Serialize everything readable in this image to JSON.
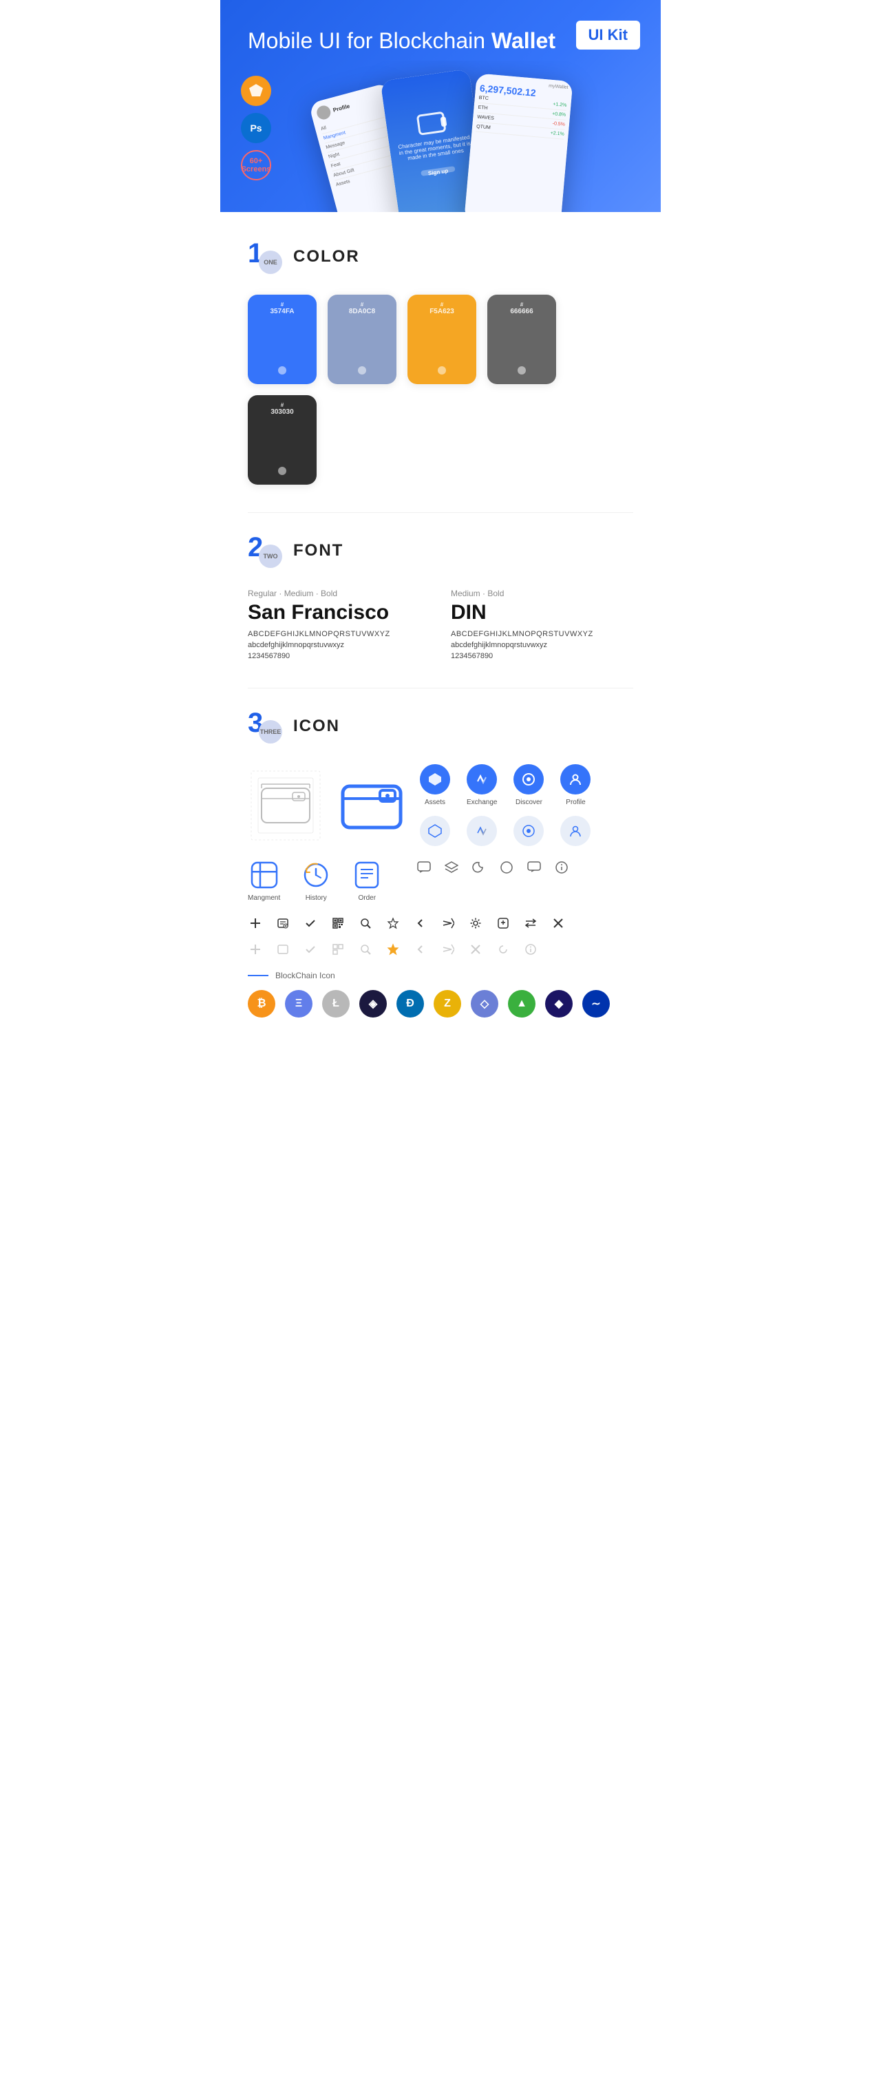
{
  "hero": {
    "title_part1": "Mobile UI for Blockchain ",
    "title_bold": "Wallet",
    "uikit_label": "UI Kit",
    "badge_sketch": "S",
    "badge_ps": "Ps",
    "badge_screens_top": "60+",
    "badge_screens_bottom": "Screens"
  },
  "sections": {
    "color": {
      "number": "1",
      "number_label": "ONE",
      "title": "COLOR",
      "swatches": [
        {
          "hex": "#3574FA",
          "code": "3574FA",
          "dark": false
        },
        {
          "hex": "#8DA0C8",
          "code": "8DA0C8",
          "dark": false
        },
        {
          "hex": "#F5A623",
          "code": "F5A623",
          "dark": false
        },
        {
          "hex": "#666666",
          "code": "666666",
          "dark": false
        },
        {
          "hex": "#303030",
          "code": "303030",
          "dark": false
        }
      ]
    },
    "font": {
      "number": "2",
      "number_label": "TWO",
      "title": "FONT",
      "font1": {
        "style_label": "Regular · Medium · Bold",
        "name": "San Francisco",
        "abc_upper": "ABCDEFGHIJKLMNOPQRSTUVWXYZ",
        "abc_lower": "abcdefghijklmnopqrstuvwxyz",
        "nums": "1234567890"
      },
      "font2": {
        "style_label": "Medium · Bold",
        "name": "DIN",
        "abc_upper": "ABCDEFGHIJKLMNOPQRSTUVWXYZ",
        "abc_lower": "abcdefghijklmnopqrstuvwxyz",
        "nums": "1234567890"
      }
    },
    "icon": {
      "number": "3",
      "number_label": "THREE",
      "title": "ICON",
      "nav_icons": [
        {
          "label": "Assets",
          "colored": true
        },
        {
          "label": "Exchange",
          "colored": true
        },
        {
          "label": "Discover",
          "colored": true
        },
        {
          "label": "Profile",
          "colored": true
        }
      ],
      "app_icons": [
        {
          "label": "Mangment"
        },
        {
          "label": "History"
        },
        {
          "label": "Order"
        }
      ]
    },
    "blockchain": {
      "label": "BlockChain Icon",
      "icons": [
        {
          "symbol": "₿",
          "color": "#F7931A",
          "name": "Bitcoin"
        },
        {
          "symbol": "Ξ",
          "color": "#627EEA",
          "name": "Ethereum"
        },
        {
          "symbol": "Ł",
          "color": "#B8B8B8",
          "name": "Litecoin"
        },
        {
          "symbol": "◈",
          "color": "#1B193F",
          "name": "Feather"
        },
        {
          "symbol": "D",
          "color": "#006DB0",
          "name": "Dash"
        },
        {
          "symbol": "Z",
          "color": "#E9B208",
          "name": "Zcash"
        },
        {
          "symbol": "◇",
          "color": "#6B7FD6",
          "name": "Network"
        },
        {
          "symbol": "▲",
          "color": "#3AB03E",
          "name": "Augur"
        },
        {
          "symbol": "◆",
          "color": "#1B1464",
          "name": "Diamond"
        },
        {
          "symbol": "~",
          "color": "#0033AD",
          "name": "Polygon"
        }
      ]
    }
  }
}
